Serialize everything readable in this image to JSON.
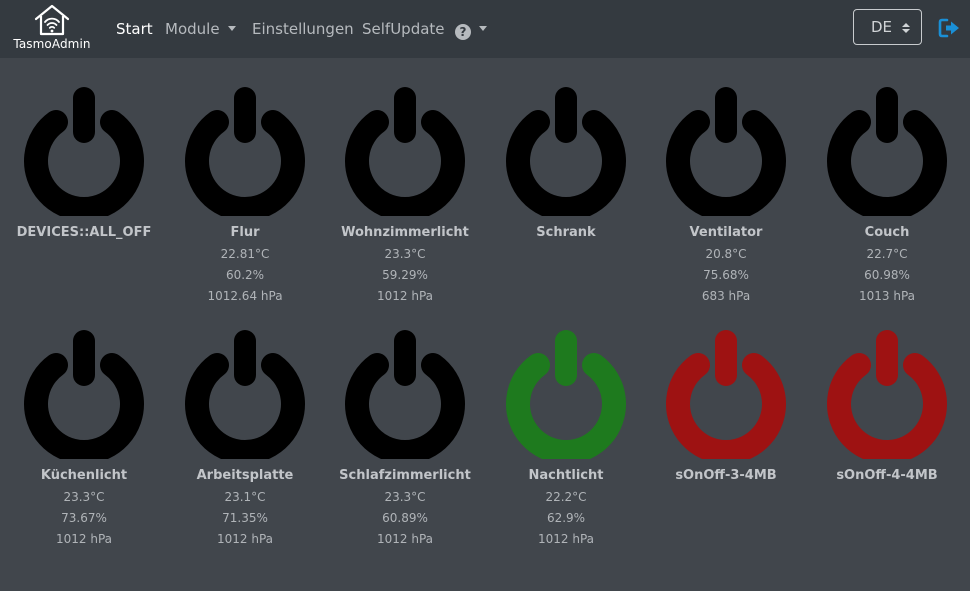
{
  "brand": {
    "name": "TasmoAdmin"
  },
  "nav": {
    "start": "Start",
    "module": "Module",
    "settings": "Einstellungen",
    "selfupdate": "SelfUpdate"
  },
  "language": {
    "selected": "DE"
  },
  "colors": {
    "off": "#000000",
    "on": "#1e7a1e",
    "offline": "#9e1212",
    "navbar": "#343a40",
    "background": "#41464c"
  },
  "devices": [
    {
      "name": "DEVICES::ALL_OFF",
      "state": "off",
      "temp": "",
      "humidity": "",
      "pressure": ""
    },
    {
      "name": "Flur",
      "state": "off",
      "temp": "22.81°C",
      "humidity": "60.2%",
      "pressure": "1012.64 hPa"
    },
    {
      "name": "Wohnzimmerlicht",
      "state": "off",
      "temp": "23.3°C",
      "humidity": "59.29%",
      "pressure": "1012 hPa"
    },
    {
      "name": "Schrank",
      "state": "off",
      "temp": "",
      "humidity": "",
      "pressure": ""
    },
    {
      "name": "Ventilator",
      "state": "off",
      "temp": "20.8°C",
      "humidity": "75.68%",
      "pressure": "683 hPa"
    },
    {
      "name": "Couch",
      "state": "off",
      "temp": "22.7°C",
      "humidity": "60.98%",
      "pressure": "1013 hPa"
    },
    {
      "name": "Küchenlicht",
      "state": "off",
      "temp": "23.3°C",
      "humidity": "73.67%",
      "pressure": "1012 hPa"
    },
    {
      "name": "Arbeitsplatte",
      "state": "off",
      "temp": "23.1°C",
      "humidity": "71.35%",
      "pressure": "1012 hPa"
    },
    {
      "name": "Schlafzimmerlicht",
      "state": "off",
      "temp": "23.3°C",
      "humidity": "60.89%",
      "pressure": "1012 hPa"
    },
    {
      "name": "Nachtlicht",
      "state": "on",
      "temp": "22.2°C",
      "humidity": "62.9%",
      "pressure": "1012 hPa"
    },
    {
      "name": "sOnOff-3-4MB",
      "state": "offline",
      "temp": "",
      "humidity": "",
      "pressure": ""
    },
    {
      "name": "sOnOff-4-4MB",
      "state": "offline",
      "temp": "",
      "humidity": "",
      "pressure": ""
    }
  ]
}
